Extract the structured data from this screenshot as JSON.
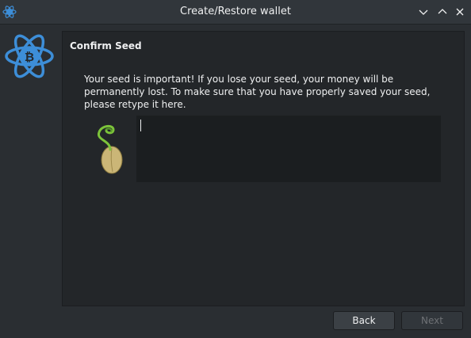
{
  "window": {
    "title": "Create/Restore wallet",
    "icons": {
      "app": "electrum-icon",
      "minimize": "chevron-down-icon",
      "maximize": "chevron-up-icon",
      "close": "close-icon"
    }
  },
  "logo": {
    "icon": "electrum-logo-icon"
  },
  "page": {
    "title": "Confirm Seed",
    "message": "Your seed is important! If you lose your seed, your money will be permanently lost. To make sure that you have properly saved your seed, please retype it here.",
    "seed_icon": "seedling-icon",
    "seed_input": {
      "value": ""
    }
  },
  "buttons": {
    "back": "Back",
    "next": "Next"
  },
  "colors": {
    "accent": "#3d8ed8",
    "background": "#2a2e32",
    "panel": "#232629",
    "input": "#1b1e20"
  }
}
